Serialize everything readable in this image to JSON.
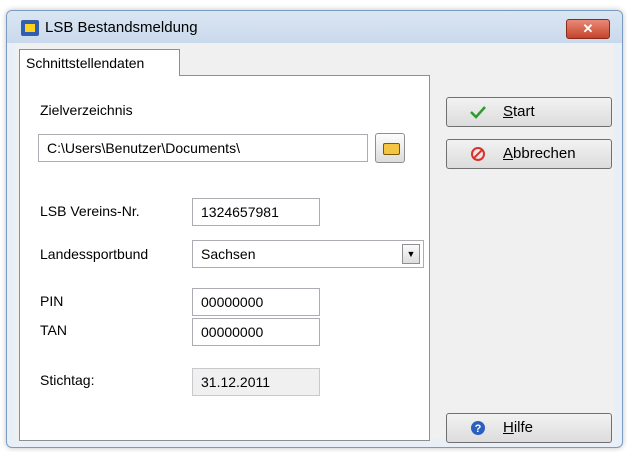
{
  "window": {
    "title": "LSB Bestandsmeldung"
  },
  "tabs": [
    {
      "label": "Schnittstellendaten"
    }
  ],
  "form": {
    "zielverzeichnis_label": "Zielverzeichnis",
    "zielverzeichnis_value": "C:\\Users\\Benutzer\\Documents\\",
    "vereinsnr_label": "LSB Vereins-Nr.",
    "vereinsnr_value": "1324657981",
    "landessportbund_label": "Landessportbund",
    "landessportbund_value": "Sachsen",
    "pin_label": "PIN",
    "pin_value": "00000000",
    "tan_label": "TAN",
    "tan_value": "00000000",
    "stichtag_label": "Stichtag:",
    "stichtag_value": "31.12.2011"
  },
  "buttons": {
    "start": {
      "prefix": "",
      "hotkey": "S",
      "rest": "tart"
    },
    "abbrechen": {
      "prefix": "",
      "hotkey": "A",
      "rest": "bbrechen"
    },
    "hilfe": {
      "prefix": "",
      "hotkey": "H",
      "rest": "ilfe"
    }
  },
  "icons": {
    "app": "app-icon",
    "close": "close-icon",
    "folder": "folder-icon",
    "dropdown": "chevron-down-icon",
    "start": "checkmark-icon",
    "cancel": "cancel-icon",
    "help": "help-icon"
  },
  "colors": {
    "title_bar": "#c9d9ec",
    "close": "#c4442a",
    "check": "#2e9b2e",
    "cancel": "#d8322a",
    "help": "#2a5fbf"
  }
}
